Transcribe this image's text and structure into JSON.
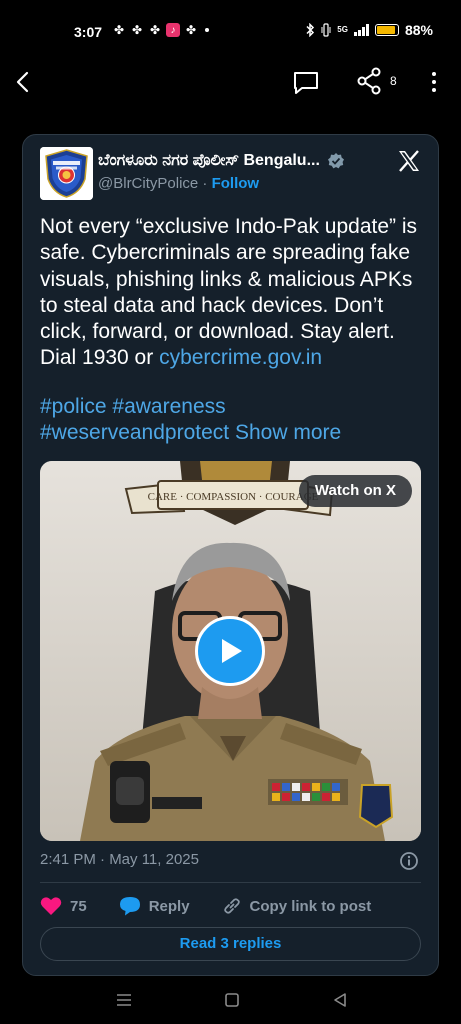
{
  "status_bar": {
    "time": "3:07",
    "battery": "88%",
    "battery_level": 0.88,
    "network": "5G",
    "accent_battery": "#f5b800"
  },
  "app_bar": {
    "share_count": "8",
    "icons": [
      "back-icon",
      "comment-icon",
      "share-icon",
      "more-icon"
    ]
  },
  "tweet": {
    "author_name": "ಬೆಂಗಳೂರು ನಗರ ಪೊಲೀಸ್ Bengalu...",
    "handle": "@BlrCityPolice",
    "separator": "·",
    "follow_label": "Follow",
    "avatar_text_top": "BENGALURU",
    "avatar_text_mid": "CITY POLICE",
    "text_main": "Not every “exclusive Indo-Pak update” is safe. Cybercriminals are spreading fake visuals, phishing links & malicious APKs to steal data and hack devices. Don’t click, forward, or download. Stay alert. Dial 1930 or ",
    "link": "cybercrime.gov.in",
    "hashtags": [
      "#police",
      "#awareness",
      "#weserveandprotect"
    ],
    "show_more": "Show more",
    "media": {
      "watch_label": "Watch on X",
      "banner_text": "CARE · COMPASSION · COURAGE"
    },
    "timestamp": "2:41 PM · May 11, 2025",
    "likes": "75",
    "reply_label": "Reply",
    "copy_link_label": "Copy link to post",
    "read_replies_label": "Read 3 replies"
  },
  "colors": {
    "card_bg": "#15202b",
    "accent_blue": "#1d9bf0",
    "link_blue": "#4ea7e6",
    "like_pink": "#f91880",
    "muted": "#8b98a5"
  }
}
